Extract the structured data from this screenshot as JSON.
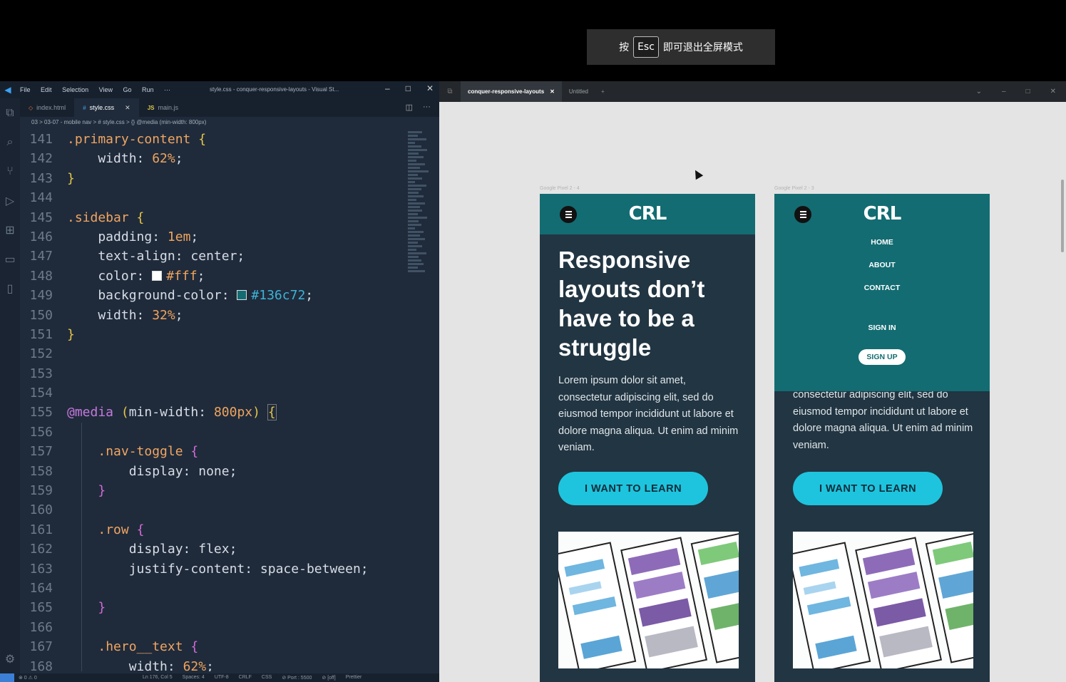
{
  "toast": {
    "prefix": "按",
    "key": "Esc",
    "suffix": "即可退出全屏模式"
  },
  "vscode": {
    "menu": [
      "File",
      "Edit",
      "Selection",
      "View",
      "Go",
      "Run",
      "···"
    ],
    "window_title": "style.css - conquer-responsive-layouts - Visual St...",
    "tabs": [
      {
        "icon": "◇",
        "label": "index.html"
      },
      {
        "icon": "#",
        "label": "style.css"
      },
      {
        "icon": "JS",
        "label": "main.js"
      }
    ],
    "breadcrumb": "03 > 03-07 - mobile nav > # style.css > {} @media (min-width: 800px)",
    "status": {
      "problems": "⊗ 0 ⚠ 0",
      "items": [
        "Ln 176, Col 5",
        "Spaces: 4",
        "UTF-8",
        "CRLF",
        "CSS",
        "⊘ Port : 5500",
        "⊘ [off]",
        "Prettier"
      ]
    }
  },
  "browser": {
    "tabs": [
      "conquer-responsive-layouts",
      "Untitled"
    ],
    "new_tab": "+",
    "devices": [
      "Google Pixel 2 - 4",
      "Google Pixel 2 - 3"
    ],
    "logo": "CRL",
    "hero_title": "Responsive layouts don’t have to be a struggle",
    "hero_body": "Lorem ipsum dolor sit amet, consectetur adipiscing elit, sed do eiusmod tempor incididunt ut labore et dolore magna aliqua. Ut enim ad minim veniam.",
    "hero_body_partial": "consectetur adipiscing elit, sed do eiusmod tempor incididunt ut labore et dolore magna aliqua. Ut enim ad minim veniam.",
    "cta": "I WANT TO LEARN",
    "nav": [
      "HOME",
      "ABOUT",
      "CONTACT",
      "SIGN IN"
    ],
    "signup": "SIGN UP"
  }
}
